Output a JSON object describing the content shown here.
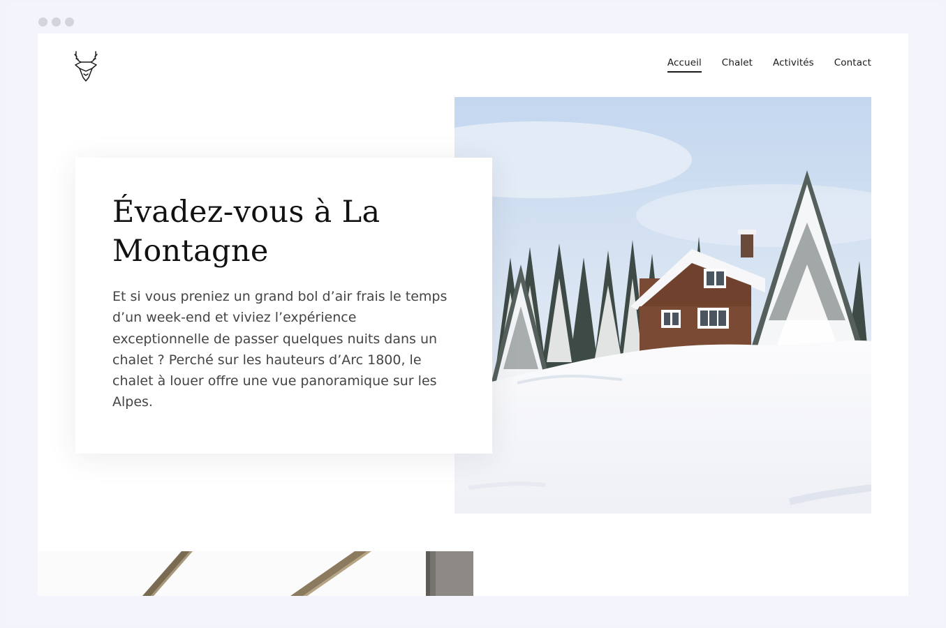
{
  "nav": {
    "items": [
      {
        "label": "Accueil",
        "active": true
      },
      {
        "label": "Chalet",
        "active": false
      },
      {
        "label": "Activités",
        "active": false
      },
      {
        "label": "Contact",
        "active": false
      }
    ]
  },
  "hero": {
    "title": "Évadez-vous à La Montagne",
    "text": "Et si vous preniez un grand bol d’air frais le temps d’un week-end et viviez l’expérience exceptionnelle de passer quelques nuits dans un chalet ? Perché sur les hauteurs d’Arc 1800, le chalet à louer offre une vue panoramique sur les Alpes."
  },
  "icons": {
    "logo": "deer-head-icon",
    "window_dot": "window-dot-icon"
  },
  "colors": {
    "background": "#f4f4fc",
    "page": "#ffffff",
    "text": "#111111",
    "body_text": "#444444"
  }
}
